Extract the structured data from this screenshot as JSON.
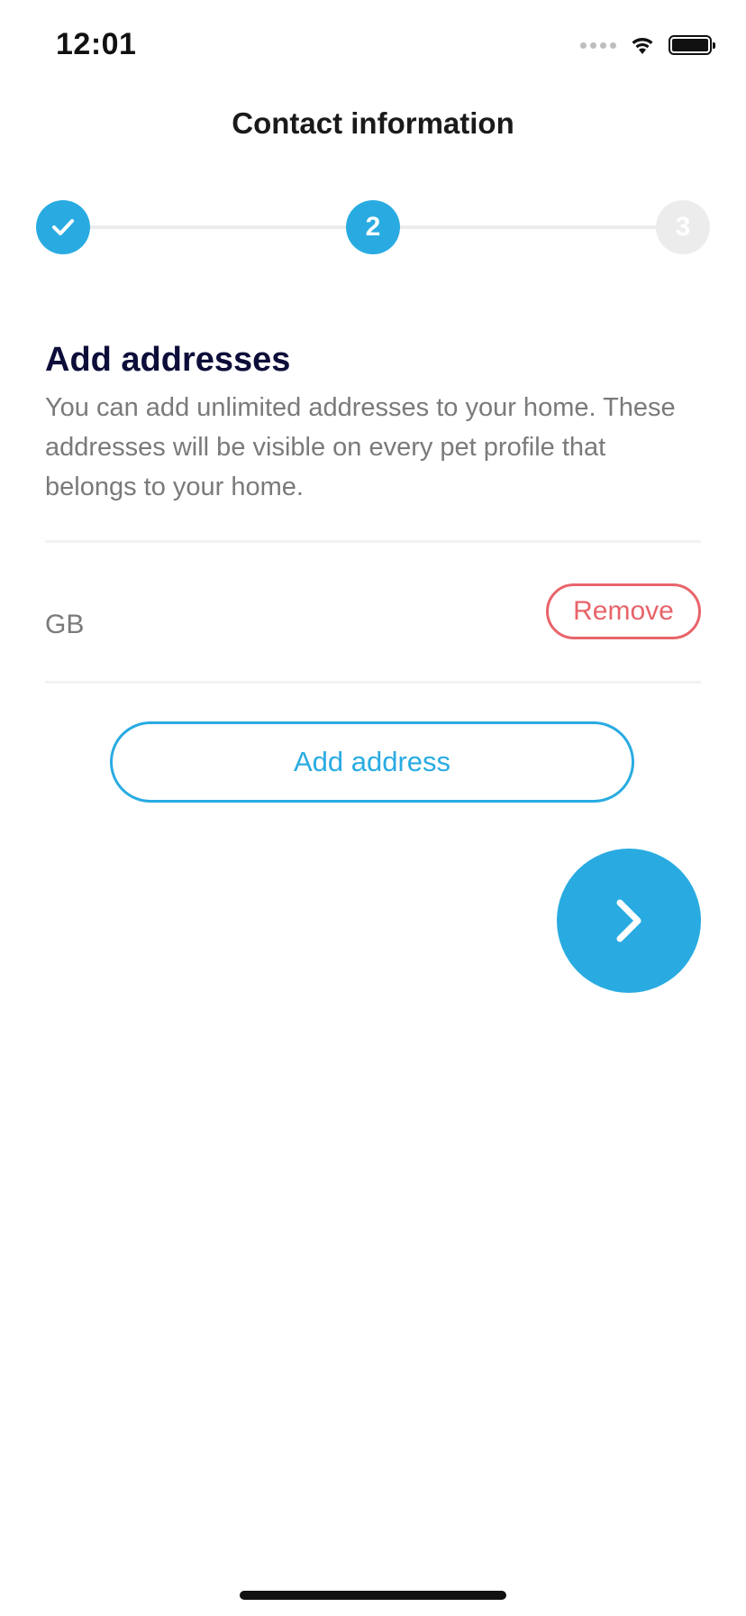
{
  "status_bar": {
    "time": "12:01",
    "icons": [
      "signal-icon",
      "wifi-icon",
      "battery-icon"
    ]
  },
  "header": {
    "title": "Contact information"
  },
  "stepper": {
    "steps": [
      {
        "label": "",
        "state": "completed",
        "icon": "check-icon"
      },
      {
        "label": "2",
        "state": "active"
      },
      {
        "label": "3",
        "state": "inactive"
      }
    ],
    "active_color": "#29abe2",
    "inactive_color": "#ececec"
  },
  "content": {
    "heading": "Add addresses",
    "description": "You can add unlimited addresses to your home. These addresses will be visible on every pet profile that belongs to your home."
  },
  "addresses": [
    {
      "text": "GB",
      "remove_label": "Remove"
    }
  ],
  "actions": {
    "add_address_label": "Add address",
    "next_icon": "chevron-right-icon"
  },
  "colors": {
    "accent": "#29abe2",
    "danger": "#e8646a",
    "heading": "#0d0d3a",
    "muted_text": "#7a7a7a"
  }
}
